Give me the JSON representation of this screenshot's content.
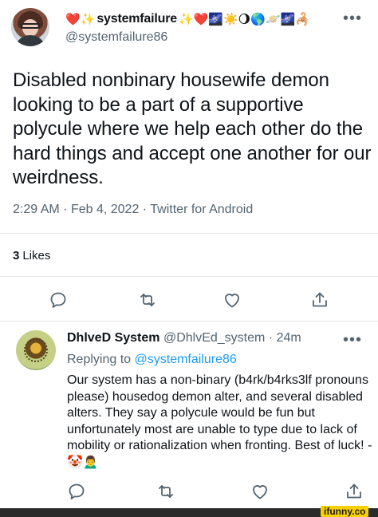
{
  "tweet": {
    "display_name": "systemfailure",
    "name_emoji_before": "❤️✨",
    "name_emoji_after": "✨❤️🌌☀️🌖🌎🪐🌌🦂",
    "handle": "@systemfailure86",
    "text": "Disabled nonbinary housewife demon looking to be a part of a supportive polycule where we help each other do the hard things and accept one another for our weirdness.",
    "time": "2:29 AM",
    "date": "Feb 4, 2022",
    "source": "Twitter for Android",
    "likes_count": "3",
    "likes_label": "Likes",
    "more_icon": "more-horizontal-icon"
  },
  "reply": {
    "display_name": "DhlveD System",
    "handle": "@DhlvEd_system",
    "age": "24m",
    "replying_prefix": "Replying to",
    "replying_to": "@systemfailure86",
    "text": "Our system has a non-binary (b4rk/b4rks3lf pronouns please) housedog demon alter, and several disabled alters. They say a polycule would be fun but unfortunately most are unable to type due to lack of mobility or rationalization when fronting. Best of luck! - 🤡🙍‍♂️"
  },
  "separator": "·",
  "watermark": "ifunny.co",
  "colors": {
    "text": "#0f1419",
    "secondary": "#536471",
    "link": "#1d9bf0",
    "divider": "#e5e7ea",
    "watermark_bg": "#f7d000"
  }
}
